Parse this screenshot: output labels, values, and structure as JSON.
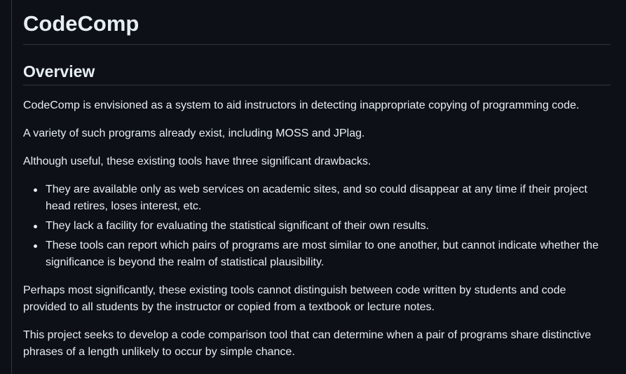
{
  "document": {
    "title": "CodeComp",
    "section_heading": "Overview",
    "paragraphs": [
      "CodeComp is envisioned as a system to aid instructors in detecting inappropriate copying of programming code.",
      "A variety of such programs already exist, including MOSS and JPlag.",
      "Although useful, these existing tools have three significant drawbacks."
    ],
    "bullets": [
      "They are available only as web services on academic sites, and so could disappear at any time if their project head retires, loses interest, etc.",
      "They lack a facility for evaluating the statistical significant of their own results.",
      "These tools can report which pairs of programs are most similar to one another, but cannot indicate whether the significance is beyond the realm of statistical plausibility."
    ],
    "closing_paragraphs": [
      "Perhaps most significantly, these existing tools cannot distinguish between code written by students and code provided to all students by the instructor or copied from a textbook or lecture notes.",
      "This project seeks to develop a code comparison tool that can determine when a pair of programs share distinctive phrases of a length unlikely to occur by simple chance."
    ]
  },
  "colors": {
    "background": "#0d1117",
    "text": "#e6edf3",
    "rule": "#30363d"
  }
}
